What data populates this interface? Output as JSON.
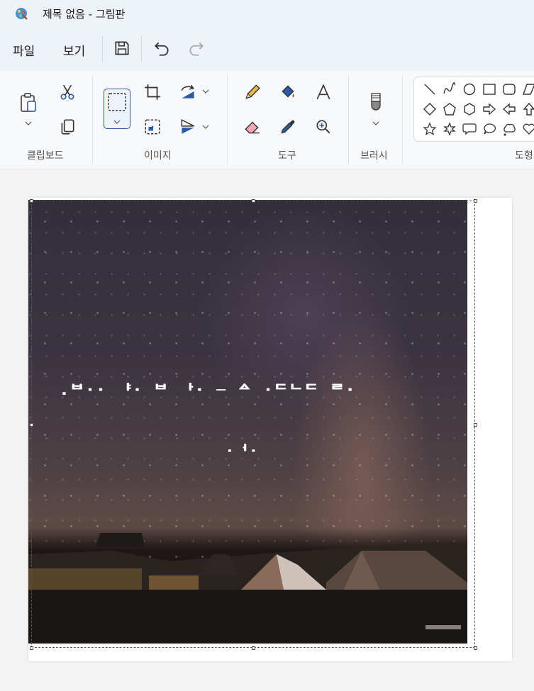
{
  "window": {
    "title": "제목 없음 - 그림판"
  },
  "menu": {
    "file": "파일",
    "view": "보기"
  },
  "ribbon": {
    "groups": {
      "clipboard": "클립보드",
      "image": "이미지",
      "tools": "도구",
      "brushes": "브러시",
      "shapes": "도형"
    }
  },
  "canvas": {
    "overlay_line1": ".ᄇ·· ᅣ· ᄇ ᅡ· ─  ᅀ  ·ᄃᄂᄃ ᄅ·",
    "overlay_line2": "·ᅥ·"
  },
  "colors": {
    "accent": "#2d5aa6",
    "titlebar_bg": "#eef2f9",
    "ribbon_bg": "#f8f9fb",
    "canvas_bg": "#ffffff",
    "workspace_bg": "#f3f3f3"
  },
  "icons": [
    "paint-app-icon",
    "save-icon",
    "undo-icon",
    "redo-icon",
    "paste-icon",
    "cut-icon",
    "copy-icon",
    "select-icon",
    "crop-icon",
    "rotate-icon",
    "resize-icon",
    "flip-icon",
    "pencil-icon",
    "fill-icon",
    "text-icon",
    "eraser-icon",
    "color-picker-icon",
    "magnifier-icon",
    "brush-icon"
  ]
}
